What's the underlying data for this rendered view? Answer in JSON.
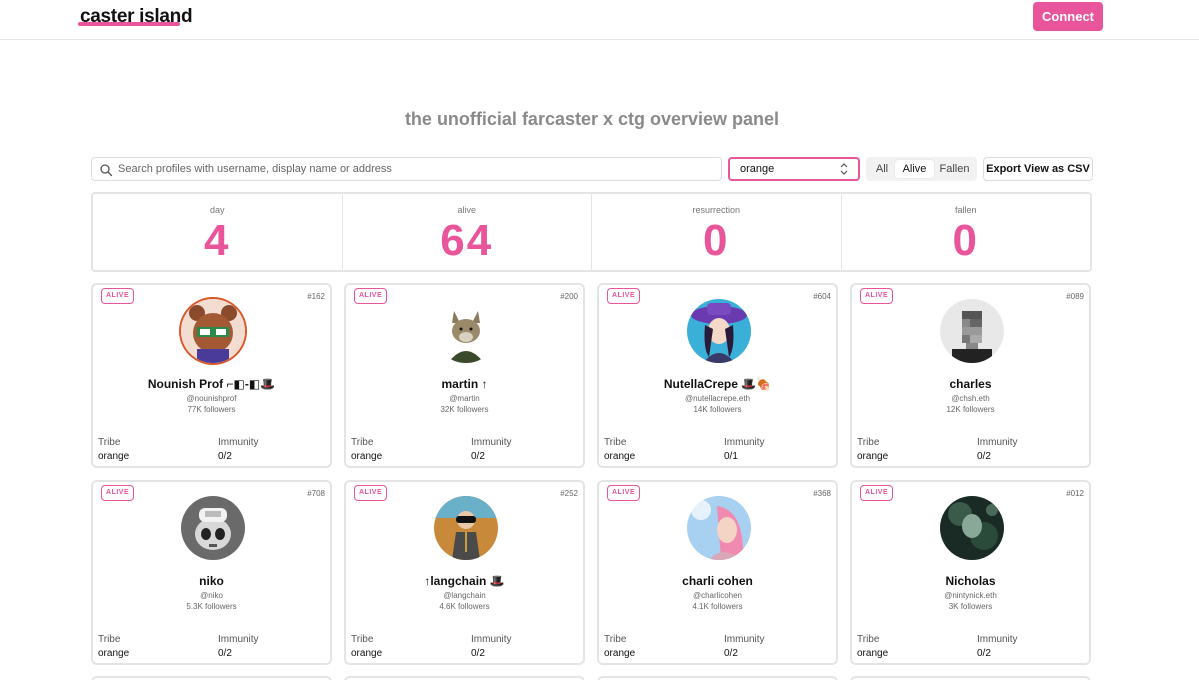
{
  "header": {
    "logo": "caster island",
    "connect_label": "Connect"
  },
  "page_title": "the unofficial farcaster x ctg overview panel",
  "search": {
    "placeholder": "Search profiles with username, display name or address",
    "icon": "search-icon"
  },
  "tribe_filter": {
    "value": "orange"
  },
  "status_filter": {
    "options": [
      "All",
      "Alive",
      "Fallen"
    ],
    "selected": "Alive"
  },
  "export_label": "Export View as CSV",
  "stats": [
    {
      "label": "day",
      "value": "4"
    },
    {
      "label": "alive",
      "value": "64"
    },
    {
      "label": "resurrection",
      "value": "0"
    },
    {
      "label": "fallen",
      "value": "0"
    }
  ],
  "field_labels": {
    "tribe": "Tribe",
    "immunity": "Immunity"
  },
  "colors": {
    "accent": "#e8559b",
    "border": "#e4e4e4",
    "title_gray": "#8a8a8a"
  },
  "cards": [
    {
      "status": "ALIVE",
      "number": "#162",
      "display_name": "Nounish Prof ⌐◧-◧🎩",
      "username": "@nounishprof",
      "followers": "77K followers",
      "tribe": "orange",
      "immunity": "0/2"
    },
    {
      "status": "ALIVE",
      "number": "#200",
      "display_name": "martin ↑",
      "username": "@martin",
      "followers": "32K followers",
      "tribe": "orange",
      "immunity": "0/2"
    },
    {
      "status": "ALIVE",
      "number": "#604",
      "display_name": "NutellaCrepe 🎩🍖",
      "username": "@nutellacrepe.eth",
      "followers": "14K followers",
      "tribe": "orange",
      "immunity": "0/1"
    },
    {
      "status": "ALIVE",
      "number": "#089",
      "display_name": "charles",
      "username": "@chsh.eth",
      "followers": "12K followers",
      "tribe": "orange",
      "immunity": "0/2"
    },
    {
      "status": "ALIVE",
      "number": "#708",
      "display_name": "niko",
      "username": "@niko",
      "followers": "5.3K followers",
      "tribe": "orange",
      "immunity": "0/2"
    },
    {
      "status": "ALIVE",
      "number": "#252",
      "display_name": "↑langchain 🎩",
      "username": "@langchain",
      "followers": "4.6K followers",
      "tribe": "orange",
      "immunity": "0/2"
    },
    {
      "status": "ALIVE",
      "number": "#368",
      "display_name": "charli cohen",
      "username": "@charlicohen",
      "followers": "4.1K followers",
      "tribe": "orange",
      "immunity": "0/2"
    },
    {
      "status": "ALIVE",
      "number": "#012",
      "display_name": "Nicholas",
      "username": "@nintynick.eth",
      "followers": "3K followers",
      "tribe": "orange",
      "immunity": "0/2"
    }
  ]
}
